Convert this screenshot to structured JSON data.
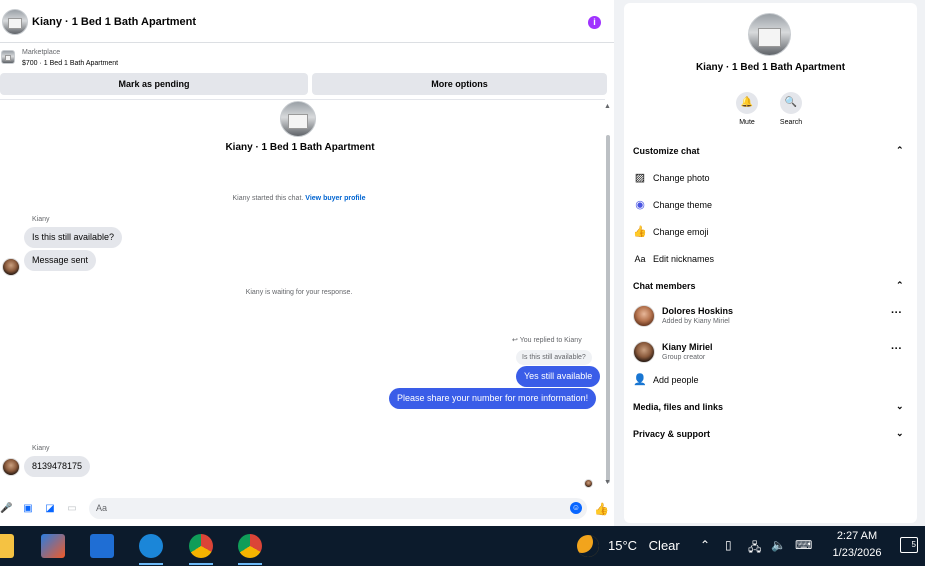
{
  "chat": {
    "header_title": "Kiany · 1 Bed 1 Bath Apartment",
    "marketplace_label": "Marketplace",
    "listing": "$700 · 1 Bed 1 Bath Apartment",
    "mark_pending": "Mark as pending",
    "more_options": "More options",
    "conversation_title": "Kiany · 1 Bed 1 Bath Apartment",
    "started_text": "Kiany started this chat.",
    "view_profile": "View buyer profile",
    "sender1": "Kiany",
    "msg1": "Is this still available?",
    "msg2": "Message sent",
    "waiting": "Kiany is waiting for your response.",
    "replied_label": "You replied to Kiany",
    "quoted": "Is this still available?",
    "out1": "Yes still available",
    "out2": "Please share your number for more information!",
    "sender2": "Kiany",
    "msg3": "8139478175",
    "input_placeholder": "Aa"
  },
  "side": {
    "title": "Kiany · 1 Bed 1 Bath Apartment",
    "mute": "Mute",
    "search": "Search",
    "customize": "Customize chat",
    "change_photo": "Change photo",
    "change_theme": "Change theme",
    "change_emoji": "Change emoji",
    "edit_nicknames": "Edit nicknames",
    "members": "Chat members",
    "member1_name": "Dolores Hoskins",
    "member1_role": "Added by Kiany Miriel",
    "member2_name": "Kiany Miriel",
    "member2_role": "Group creator",
    "add_people": "Add people",
    "media": "Media, files and links",
    "privacy": "Privacy & support"
  },
  "taskbar": {
    "temperature": "15°C",
    "condition": "Clear",
    "time": "2:27 AM",
    "date": "1/23/2026",
    "notifications": "5"
  },
  "colors": {
    "accent": "#3a5de8",
    "brand": "#0866ff",
    "info": "#a033ff"
  }
}
